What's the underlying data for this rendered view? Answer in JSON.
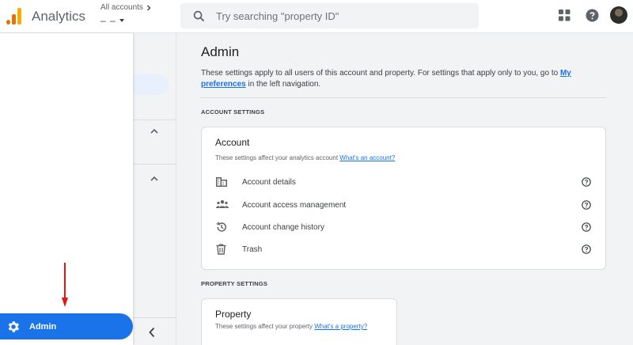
{
  "header": {
    "app_name": "Analytics",
    "account_label": "All accounts",
    "account_value": "– –",
    "search_placeholder": "Try searching \"property ID\"",
    "logo_colors": [
      "#f9ab00",
      "#e37400",
      "#e37400"
    ]
  },
  "sidebar": {
    "admin_label": "Admin",
    "admin_color": "#1a73e8",
    "arrow_color": "#e8150b"
  },
  "main": {
    "title": "Admin",
    "intro_text": "These settings apply to all users of this account and property. For settings that apply only to you, go to ",
    "intro_link": "My preferences",
    "intro_suffix": " in the left navigation.",
    "account_section": {
      "heading": "ACCOUNT SETTINGS",
      "card_title": "Account",
      "card_desc": "These settings affect your analytics account ",
      "card_link": "What's an account?",
      "items": [
        {
          "label": "Account details",
          "icon": "building-icon"
        },
        {
          "label": "Account access management",
          "icon": "people-group-icon"
        },
        {
          "label": "Account change history",
          "icon": "history-icon"
        },
        {
          "label": "Trash",
          "icon": "trash-icon"
        }
      ]
    },
    "property_section": {
      "heading": "PROPERTY SETTINGS",
      "card_title": "Property",
      "card_desc": "These settings affect your property ",
      "card_link": "What's a property?"
    }
  }
}
